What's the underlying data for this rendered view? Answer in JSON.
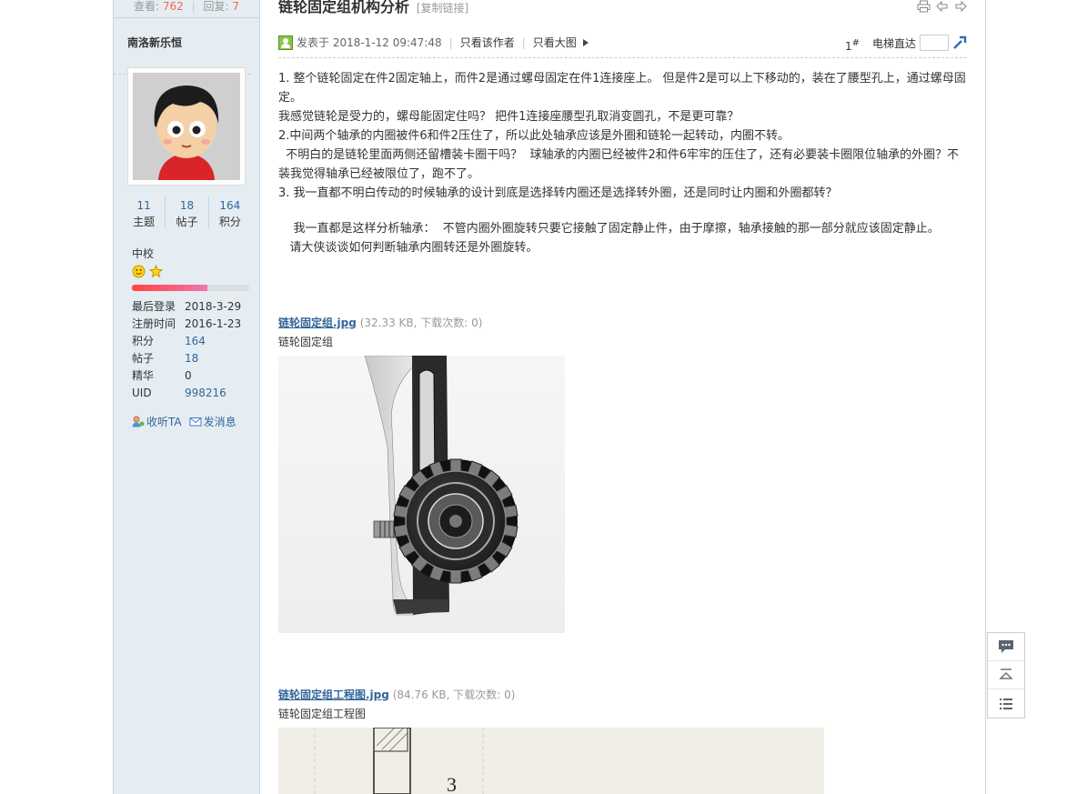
{
  "sidebar": {
    "views_label": "查看:",
    "views_value": "762",
    "replies_label": "回复:",
    "replies_value": "7",
    "author": "南洛新乐恒",
    "stats": [
      {
        "value": "11",
        "label": "主题"
      },
      {
        "value": "18",
        "label": "帖子"
      },
      {
        "value": "164",
        "label": "积分"
      }
    ],
    "rank": "中校",
    "level_progress_percent": 64,
    "info": [
      {
        "key": "最后登录",
        "value": "2018-3-29"
      },
      {
        "key": "注册时间",
        "value": "2016-1-23"
      },
      {
        "key": "积分",
        "value": "164"
      },
      {
        "key": "帖子",
        "value": "18"
      },
      {
        "key": "精华",
        "value": "0"
      },
      {
        "key": "UID",
        "value": "998216"
      }
    ],
    "follow_label": "收听TA",
    "message_label": "发消息"
  },
  "post": {
    "title": "链轮固定组机构分析",
    "copy_link": "[复制链接]",
    "posted_at": "发表于 2018-1-12 09:47:48",
    "only_author": "只看该作者",
    "only_big_image": "只看大图",
    "floor": "1",
    "floor_mark": "#",
    "elevator_label": "电梯直达",
    "paragraphs": [
      "1. 整个链轮固定在件2固定轴上，而件2是通过螺母固定在件1连接座上。 但是件2是可以上下移动的，装在了腰型孔上，通过螺母固定。",
      "我感觉链轮是受力的，螺母能固定住吗？ 把件1连接座腰型孔取消变圆孔，不是更可靠？",
      "2.中间两个轴承的内圈被件6和件2压住了，所以此处轴承应该是外圈和链轮一起转动，内圈不转。",
      "  不明白的是链轮里面两侧还留槽装卡圈干吗？  球轴承的内圈已经被件2和件6牢牢的压住了，还有必要装卡圈限位轴承的外圈？不装我觉得轴承已经被限位了，跑不了。",
      "3.  我一直都不明白传动的时候轴承的设计到底是选择转内圈还是选择转外圈，还是同时让内圈和外圈都转？",
      "",
      "    我一直都是这样分析轴承：  不管内圈外圈旋转只要它接触了固定静止件，由于摩擦，轴承接触的那一部分就应该固定静止。",
      "   请大侠谈谈如何判断轴承内圈转还是外圈旋转。"
    ],
    "attachments": [
      {
        "filename": "链轮固定组.jpg",
        "meta": "(32.33 KB, 下载次数: 0)",
        "caption": "链轮固定组"
      },
      {
        "filename": "链轮固定组工程图.jpg",
        "meta": "(84.76 KB, 下载次数: 0)",
        "caption": "链轮固定组工程图"
      }
    ],
    "drawing_label": "3"
  },
  "icons": {
    "print": "printer-icon",
    "prev": "prev-thread-icon",
    "next": "next-thread-icon",
    "go": "go-arrow-icon"
  }
}
